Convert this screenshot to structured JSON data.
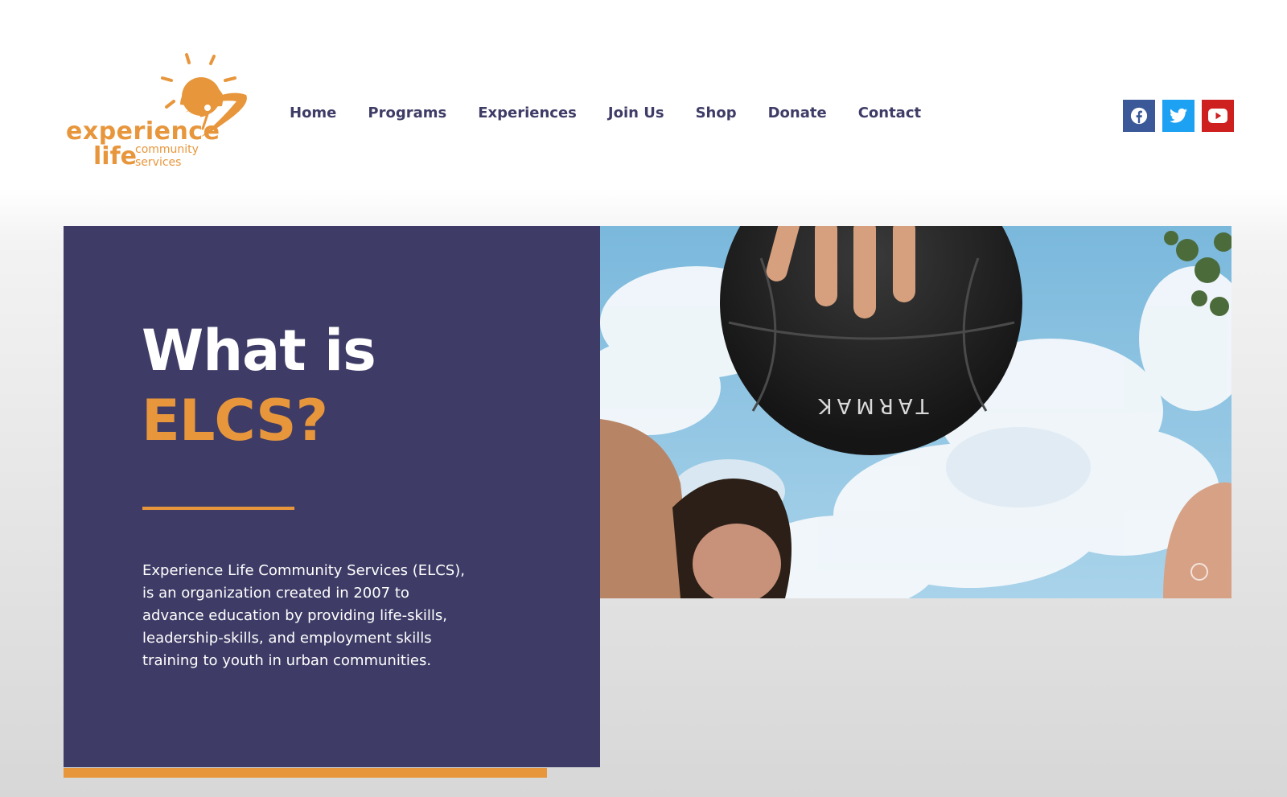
{
  "logo": {
    "word1": "experience",
    "word2": "life",
    "sub1": "community",
    "sub2": "services",
    "icon": "sun-swoosh-logo",
    "color": "#e8963c"
  },
  "nav": {
    "items": [
      {
        "label": "Home"
      },
      {
        "label": "Programs"
      },
      {
        "label": "Experiences"
      },
      {
        "label": "Join Us"
      },
      {
        "label": "Shop"
      },
      {
        "label": "Donate"
      },
      {
        "label": "Contact"
      }
    ]
  },
  "social": [
    {
      "icon": "facebook-icon",
      "color": "#3b5998"
    },
    {
      "icon": "twitter-icon",
      "color": "#1da1f2"
    },
    {
      "icon": "youtube-icon",
      "color": "#cd201f"
    }
  ],
  "hero": {
    "title_line1": "What is",
    "title_line2": "ELCS?",
    "description": "Experience Life Community Services (ELCS), is an organization created in 2007 to advance education by providing life-skills, leadership-skills, and employment skills training to youth in urban communities.",
    "panel_color": "#3e3c66",
    "accent_color": "#e8963c",
    "photo": {
      "subject": "basketball-held-overhead-sky-photo",
      "ball_text": "TARMAK"
    }
  }
}
